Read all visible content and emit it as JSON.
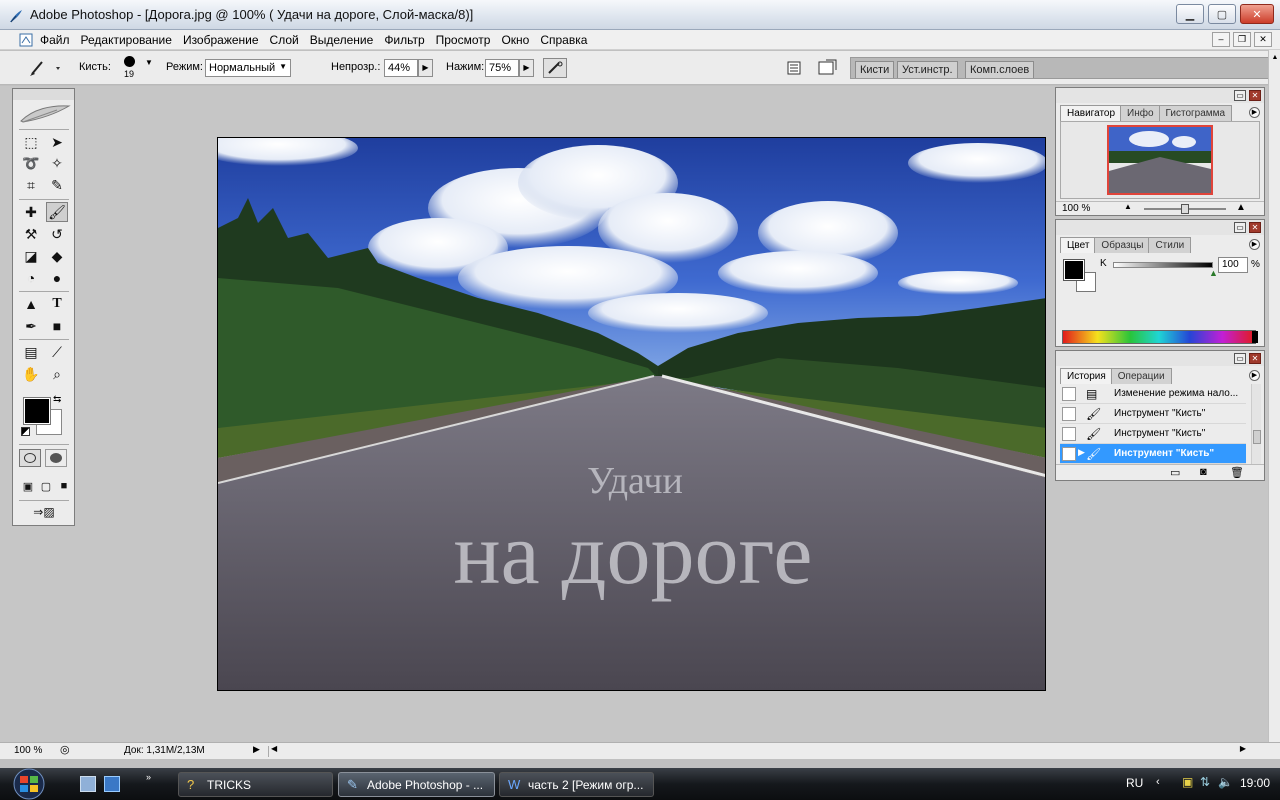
{
  "window": {
    "title": "Adobe Photoshop - [Дорога.jpg @ 100% (  Удачи  на дороге, Слой-маска/8)]",
    "controls": [
      "minimize",
      "maximize",
      "close"
    ]
  },
  "menu": [
    "Файл",
    "Редактирование",
    "Изображение",
    "Слой",
    "Выделение",
    "Фильтр",
    "Просмотр",
    "Окно",
    "Справка"
  ],
  "options": {
    "brush_label": "Кисть:",
    "brush_size": "19",
    "mode_label": "Режим:",
    "mode_value": "Нормальный",
    "opacity_label": "Непрозр.:",
    "opacity_value": "44%",
    "flow_label": "Нажим:",
    "flow_value": "75%",
    "well_tabs": [
      "Кисти",
      "Уст.инстр.",
      "Комп.слоев"
    ]
  },
  "canvas": {
    "text_line1": "Удачи",
    "text_line2": "на дороге"
  },
  "navigator": {
    "tabs": [
      "Навигатор",
      "Инфо",
      "Гистограмма"
    ],
    "zoom": "100 %"
  },
  "color": {
    "tabs": [
      "Цвет",
      "Образцы",
      "Стили"
    ],
    "channel_label": "K",
    "channel_value": "100",
    "unit": "%"
  },
  "history": {
    "tabs": [
      "История",
      "Операции"
    ],
    "items": [
      {
        "label": "Изменение режима нало..."
      },
      {
        "label": "Инструмент \"Кисть\""
      },
      {
        "label": "Инструмент \"Кисть\""
      },
      {
        "label": "Инструмент \"Кисть\""
      }
    ]
  },
  "status": {
    "zoom": "100 %",
    "doc": "Док: 1,31M/2,13M"
  },
  "taskbar": {
    "tasks": [
      {
        "label": "TRICKS"
      },
      {
        "label": "Adobe Photoshop - ..."
      },
      {
        "label": "часть 2 [Режим огр..."
      }
    ],
    "lang": "RU",
    "time": "19:00"
  },
  "colors": {
    "selection": "#3399ff",
    "panel_bg": "#ececec",
    "workspace": "#c6c6c6"
  }
}
